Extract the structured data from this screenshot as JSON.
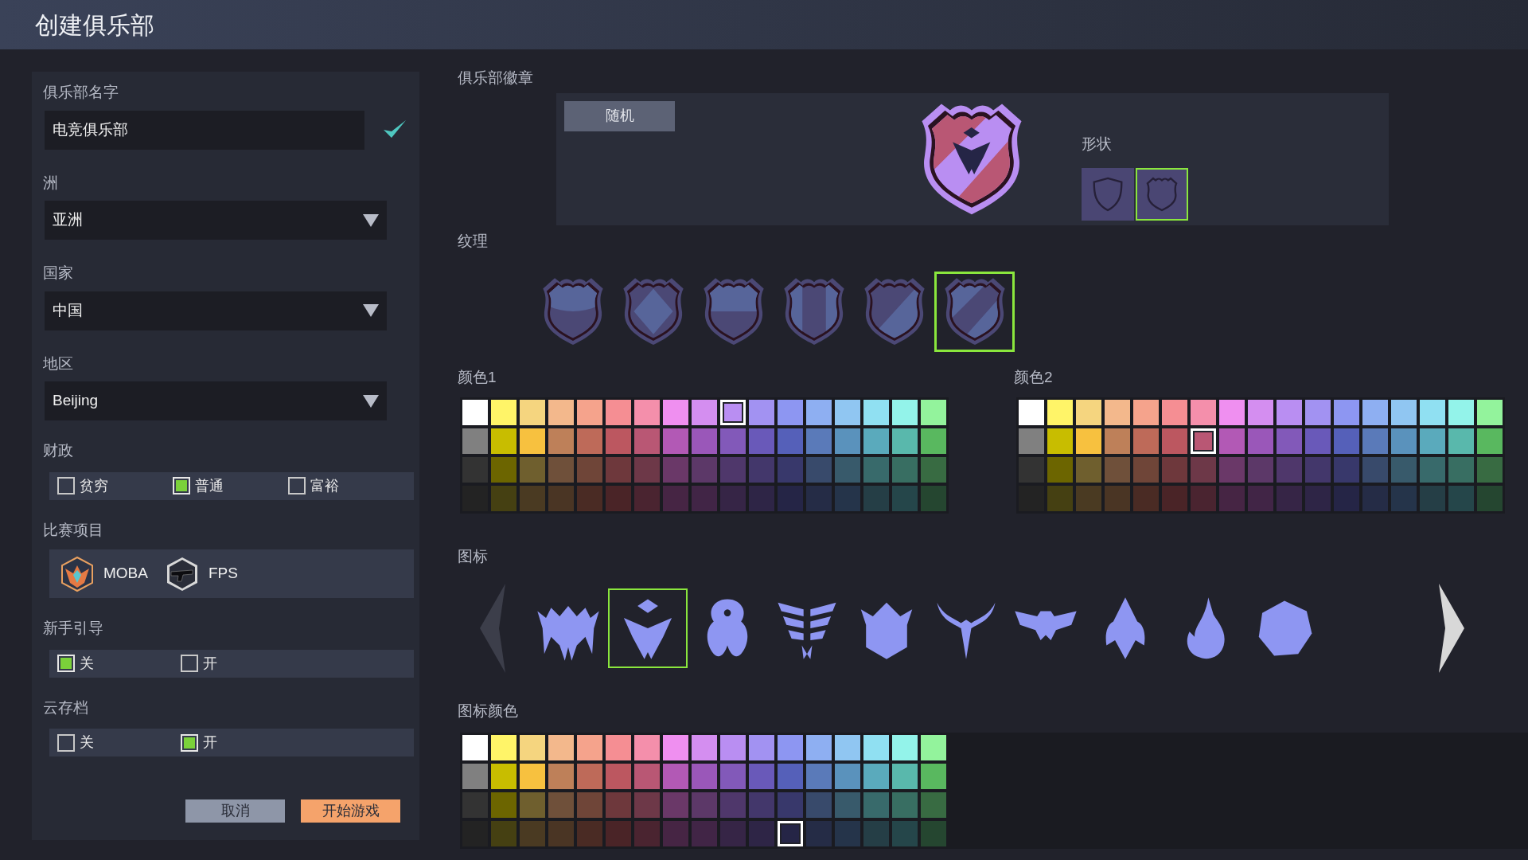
{
  "header": {
    "title": "创建俱乐部"
  },
  "form": {
    "club_name": {
      "label": "俱乐部名字",
      "value": "电竞俱乐部",
      "valid": true
    },
    "continent": {
      "label": "洲",
      "value": "亚洲"
    },
    "country": {
      "label": "国家",
      "value": "中国"
    },
    "region": {
      "label": "地区",
      "value": "Beijing"
    },
    "finance": {
      "label": "财政",
      "options": [
        {
          "label": "贫穷",
          "checked": false
        },
        {
          "label": "普通",
          "checked": true
        },
        {
          "label": "富裕",
          "checked": false
        }
      ]
    },
    "game_types": {
      "label": "比赛项目",
      "items": [
        {
          "label": "MOBA",
          "kind": "moba"
        },
        {
          "label": "FPS",
          "kind": "fps"
        }
      ]
    },
    "tutorial": {
      "label": "新手引导",
      "options": [
        {
          "label": "关",
          "checked": true
        },
        {
          "label": "开",
          "checked": false
        }
      ]
    },
    "cloud_save": {
      "label": "云存档",
      "options": [
        {
          "label": "关",
          "checked": false
        },
        {
          "label": "开",
          "checked": true
        }
      ]
    },
    "buttons": [
      {
        "label": "取消",
        "kind": "secondary"
      },
      {
        "label": "开始游戏",
        "kind": "primary"
      }
    ]
  },
  "badge": {
    "label": "俱乐部徽章",
    "random_button": "随机",
    "shape_label": "形状",
    "shapes": [
      {
        "kind": "plain",
        "selected": false
      },
      {
        "kind": "wavy",
        "selected": true
      }
    ]
  },
  "texture": {
    "label": "纹理",
    "items": [
      {
        "kind": "curve",
        "selected": false
      },
      {
        "kind": "diamond",
        "selected": false
      },
      {
        "kind": "band",
        "selected": false
      },
      {
        "kind": "stripe",
        "selected": false
      },
      {
        "kind": "diagonal",
        "selected": false
      },
      {
        "kind": "slash",
        "selected": true
      }
    ]
  },
  "color1": {
    "label": "颜色1",
    "rows": [
      [
        {
          "color": "#ffffff",
          "selected": false
        },
        {
          "color": "#fff468",
          "selected": false
        },
        {
          "color": "#f5d57f",
          "selected": false
        },
        {
          "color": "#f3b88c",
          "selected": false
        },
        {
          "color": "#f5a38c",
          "selected": false
        },
        {
          "color": "#f58e93",
          "selected": false
        },
        {
          "color": "#f48fab",
          "selected": false
        },
        {
          "color": "#ef8ff0",
          "selected": false
        },
        {
          "color": "#d48ef0",
          "selected": false
        },
        {
          "color": "#b98ef2",
          "selected": true
        },
        {
          "color": "#a292f2",
          "selected": false
        },
        {
          "color": "#8d96f2",
          "selected": false
        },
        {
          "color": "#8eaff2",
          "selected": false
        },
        {
          "color": "#90c6f2",
          "selected": false
        },
        {
          "color": "#90e0f2",
          "selected": false
        },
        {
          "color": "#93f3ea",
          "selected": false
        },
        {
          "color": "#93f39c",
          "selected": false
        }
      ],
      [
        {
          "color": "#808080",
          "selected": false
        },
        {
          "color": "#c8bd00",
          "selected": false
        },
        {
          "color": "#f7c13f",
          "selected": false
        },
        {
          "color": "#be8059",
          "selected": false
        },
        {
          "color": "#be6a59",
          "selected": false
        },
        {
          "color": "#bc5760",
          "selected": false
        },
        {
          "color": "#b95774",
          "selected": false
        },
        {
          "color": "#b259b5",
          "selected": false
        },
        {
          "color": "#9a57b9",
          "selected": false
        },
        {
          "color": "#8259b9",
          "selected": false
        },
        {
          "color": "#6959b9",
          "selected": false
        },
        {
          "color": "#5560b9",
          "selected": false
        },
        {
          "color": "#5a7ab9",
          "selected": false
        },
        {
          "color": "#5a92bc",
          "selected": false
        },
        {
          "color": "#5aaabc",
          "selected": false
        },
        {
          "color": "#59b8ac",
          "selected": false
        },
        {
          "color": "#59b85f",
          "selected": false
        }
      ],
      [
        {
          "color": "#333333",
          "selected": false
        },
        {
          "color": "#6c6500",
          "selected": false
        },
        {
          "color": "#6f5f2e",
          "selected": false
        },
        {
          "color": "#6f503a",
          "selected": false
        },
        {
          "color": "#6f4538",
          "selected": false
        },
        {
          "color": "#6e383c",
          "selected": false
        },
        {
          "color": "#6d3848",
          "selected": false
        },
        {
          "color": "#6a3868",
          "selected": false
        },
        {
          "color": "#5c3868",
          "selected": false
        },
        {
          "color": "#4f376b",
          "selected": false
        },
        {
          "color": "#43376b",
          "selected": false
        },
        {
          "color": "#38386b",
          "selected": false
        },
        {
          "color": "#384a6b",
          "selected": false
        },
        {
          "color": "#385a6b",
          "selected": false
        },
        {
          "color": "#386a6b",
          "selected": false
        },
        {
          "color": "#386e62",
          "selected": false
        },
        {
          "color": "#386b42",
          "selected": false
        }
      ],
      [
        {
          "color": "#232323",
          "selected": false
        },
        {
          "color": "#454012",
          "selected": false
        },
        {
          "color": "#4a3a22",
          "selected": false
        },
        {
          "color": "#4a3524",
          "selected": false
        },
        {
          "color": "#4a2b24",
          "selected": false
        },
        {
          "color": "#4a2427",
          "selected": false
        },
        {
          "color": "#4a2430",
          "selected": false
        },
        {
          "color": "#462544",
          "selected": false
        },
        {
          "color": "#412546",
          "selected": false
        },
        {
          "color": "#362546",
          "selected": false
        },
        {
          "color": "#2e2546",
          "selected": false
        },
        {
          "color": "#252546",
          "selected": false
        },
        {
          "color": "#252c46",
          "selected": false
        },
        {
          "color": "#25344a",
          "selected": false
        },
        {
          "color": "#253e46",
          "selected": false
        },
        {
          "color": "#25464a",
          "selected": false
        },
        {
          "color": "#254630",
          "selected": false
        }
      ]
    ]
  },
  "color2": {
    "label": "颜色2",
    "rows": [
      [
        {
          "color": "#ffffff",
          "selected": false
        },
        {
          "color": "#fff468",
          "selected": false
        },
        {
          "color": "#f5d57f",
          "selected": false
        },
        {
          "color": "#f3b88c",
          "selected": false
        },
        {
          "color": "#f5a38c",
          "selected": false
        },
        {
          "color": "#f58e93",
          "selected": false
        },
        {
          "color": "#f48fab",
          "selected": false
        },
        {
          "color": "#ef8ff0",
          "selected": false
        },
        {
          "color": "#d48ef0",
          "selected": false
        },
        {
          "color": "#b98ef2",
          "selected": false
        },
        {
          "color": "#a292f2",
          "selected": false
        },
        {
          "color": "#8d96f2",
          "selected": false
        },
        {
          "color": "#8eaff2",
          "selected": false
        },
        {
          "color": "#90c6f2",
          "selected": false
        },
        {
          "color": "#90e0f2",
          "selected": false
        },
        {
          "color": "#93f3ea",
          "selected": false
        },
        {
          "color": "#93f39c",
          "selected": false
        }
      ],
      [
        {
          "color": "#808080",
          "selected": false
        },
        {
          "color": "#c8bd00",
          "selected": false
        },
        {
          "color": "#f7c13f",
          "selected": false
        },
        {
          "color": "#be8059",
          "selected": false
        },
        {
          "color": "#be6a59",
          "selected": false
        },
        {
          "color": "#bc5760",
          "selected": false
        },
        {
          "color": "#b95774",
          "selected": true
        },
        {
          "color": "#b259b5",
          "selected": false
        },
        {
          "color": "#9a57b9",
          "selected": false
        },
        {
          "color": "#8259b9",
          "selected": false
        },
        {
          "color": "#6959b9",
          "selected": false
        },
        {
          "color": "#5560b9",
          "selected": false
        },
        {
          "color": "#5a7ab9",
          "selected": false
        },
        {
          "color": "#5a92bc",
          "selected": false
        },
        {
          "color": "#5aaabc",
          "selected": false
        },
        {
          "color": "#59b8ac",
          "selected": false
        },
        {
          "color": "#59b85f",
          "selected": false
        }
      ],
      [
        {
          "color": "#333333",
          "selected": false
        },
        {
          "color": "#6c6500",
          "selected": false
        },
        {
          "color": "#6f5f2e",
          "selected": false
        },
        {
          "color": "#6f503a",
          "selected": false
        },
        {
          "color": "#6f4538",
          "selected": false
        },
        {
          "color": "#6e383c",
          "selected": false
        },
        {
          "color": "#6d3848",
          "selected": false
        },
        {
          "color": "#6a3868",
          "selected": false
        },
        {
          "color": "#5c3868",
          "selected": false
        },
        {
          "color": "#4f376b",
          "selected": false
        },
        {
          "color": "#43376b",
          "selected": false
        },
        {
          "color": "#38386b",
          "selected": false
        },
        {
          "color": "#384a6b",
          "selected": false
        },
        {
          "color": "#385a6b",
          "selected": false
        },
        {
          "color": "#386a6b",
          "selected": false
        },
        {
          "color": "#386e62",
          "selected": false
        },
        {
          "color": "#386b42",
          "selected": false
        }
      ],
      [
        {
          "color": "#232323",
          "selected": false
        },
        {
          "color": "#454012",
          "selected": false
        },
        {
          "color": "#4a3a22",
          "selected": false
        },
        {
          "color": "#4a3524",
          "selected": false
        },
        {
          "color": "#4a2b24",
          "selected": false
        },
        {
          "color": "#4a2427",
          "selected": false
        },
        {
          "color": "#4a2430",
          "selected": false
        },
        {
          "color": "#462544",
          "selected": false
        },
        {
          "color": "#412546",
          "selected": false
        },
        {
          "color": "#362546",
          "selected": false
        },
        {
          "color": "#2e2546",
          "selected": false
        },
        {
          "color": "#252546",
          "selected": false
        },
        {
          "color": "#252c46",
          "selected": false
        },
        {
          "color": "#25344a",
          "selected": false
        },
        {
          "color": "#253e46",
          "selected": false
        },
        {
          "color": "#25464a",
          "selected": false
        },
        {
          "color": "#254630",
          "selected": false
        }
      ]
    ]
  },
  "icons": {
    "label": "图标",
    "items": [
      {
        "kind": "wings",
        "selected": false
      },
      {
        "kind": "arrowhead",
        "selected": true
      },
      {
        "kind": "bug",
        "selected": false
      },
      {
        "kind": "stripes",
        "selected": false
      },
      {
        "kind": "crown",
        "selected": false
      },
      {
        "kind": "eagle",
        "selected": false
      },
      {
        "kind": "winged",
        "selected": false
      },
      {
        "kind": "rocket",
        "selected": false
      },
      {
        "kind": "flame",
        "selected": false
      },
      {
        "kind": "hexagon",
        "selected": false
      }
    ]
  },
  "icon_color": {
    "label": "图标颜色",
    "rows": [
      [
        {
          "color": "#ffffff",
          "selected": false
        },
        {
          "color": "#fff468",
          "selected": false
        },
        {
          "color": "#f5d57f",
          "selected": false
        },
        {
          "color": "#f3b88c",
          "selected": false
        },
        {
          "color": "#f5a38c",
          "selected": false
        },
        {
          "color": "#f58e93",
          "selected": false
        },
        {
          "color": "#f48fab",
          "selected": false
        },
        {
          "color": "#ef8ff0",
          "selected": false
        },
        {
          "color": "#d48ef0",
          "selected": false
        },
        {
          "color": "#b98ef2",
          "selected": false
        },
        {
          "color": "#a292f2",
          "selected": false
        },
        {
          "color": "#8d96f2",
          "selected": false
        },
        {
          "color": "#8eaff2",
          "selected": false
        },
        {
          "color": "#90c6f2",
          "selected": false
        },
        {
          "color": "#90e0f2",
          "selected": false
        },
        {
          "color": "#93f3ea",
          "selected": false
        },
        {
          "color": "#93f39c",
          "selected": false
        }
      ],
      [
        {
          "color": "#808080",
          "selected": false
        },
        {
          "color": "#c8bd00",
          "selected": false
        },
        {
          "color": "#f7c13f",
          "selected": false
        },
        {
          "color": "#be8059",
          "selected": false
        },
        {
          "color": "#be6a59",
          "selected": false
        },
        {
          "color": "#bc5760",
          "selected": false
        },
        {
          "color": "#b95774",
          "selected": false
        },
        {
          "color": "#b259b5",
          "selected": false
        },
        {
          "color": "#9a57b9",
          "selected": false
        },
        {
          "color": "#8259b9",
          "selected": false
        },
        {
          "color": "#6959b9",
          "selected": false
        },
        {
          "color": "#5560b9",
          "selected": false
        },
        {
          "color": "#5a7ab9",
          "selected": false
        },
        {
          "color": "#5a92bc",
          "selected": false
        },
        {
          "color": "#5aaabc",
          "selected": false
        },
        {
          "color": "#59b8ac",
          "selected": false
        },
        {
          "color": "#59b85f",
          "selected": false
        }
      ],
      [
        {
          "color": "#333333",
          "selected": false
        },
        {
          "color": "#6c6500",
          "selected": false
        },
        {
          "color": "#6f5f2e",
          "selected": false
        },
        {
          "color": "#6f503a",
          "selected": false
        },
        {
          "color": "#6f4538",
          "selected": false
        },
        {
          "color": "#6e383c",
          "selected": false
        },
        {
          "color": "#6d3848",
          "selected": false
        },
        {
          "color": "#6a3868",
          "selected": false
        },
        {
          "color": "#5c3868",
          "selected": false
        },
        {
          "color": "#4f376b",
          "selected": false
        },
        {
          "color": "#43376b",
          "selected": false
        },
        {
          "color": "#38386b",
          "selected": false
        },
        {
          "color": "#384a6b",
          "selected": false
        },
        {
          "color": "#385a6b",
          "selected": false
        },
        {
          "color": "#386a6b",
          "selected": false
        },
        {
          "color": "#386e62",
          "selected": false
        },
        {
          "color": "#386b42",
          "selected": false
        }
      ],
      [
        {
          "color": "#232323",
          "selected": false
        },
        {
          "color": "#454012",
          "selected": false
        },
        {
          "color": "#4a3a22",
          "selected": false
        },
        {
          "color": "#4a3524",
          "selected": false
        },
        {
          "color": "#4a2b24",
          "selected": false
        },
        {
          "color": "#4a2427",
          "selected": false
        },
        {
          "color": "#4a2430",
          "selected": false
        },
        {
          "color": "#462544",
          "selected": false
        },
        {
          "color": "#412546",
          "selected": false
        },
        {
          "color": "#362546",
          "selected": false
        },
        {
          "color": "#2e2546",
          "selected": false
        },
        {
          "color": "#252546",
          "selected": true
        },
        {
          "color": "#252c46",
          "selected": false
        },
        {
          "color": "#25344a",
          "selected": false
        },
        {
          "color": "#253e46",
          "selected": false
        },
        {
          "color": "#25464a",
          "selected": false
        },
        {
          "color": "#254630",
          "selected": false
        }
      ]
    ]
  }
}
